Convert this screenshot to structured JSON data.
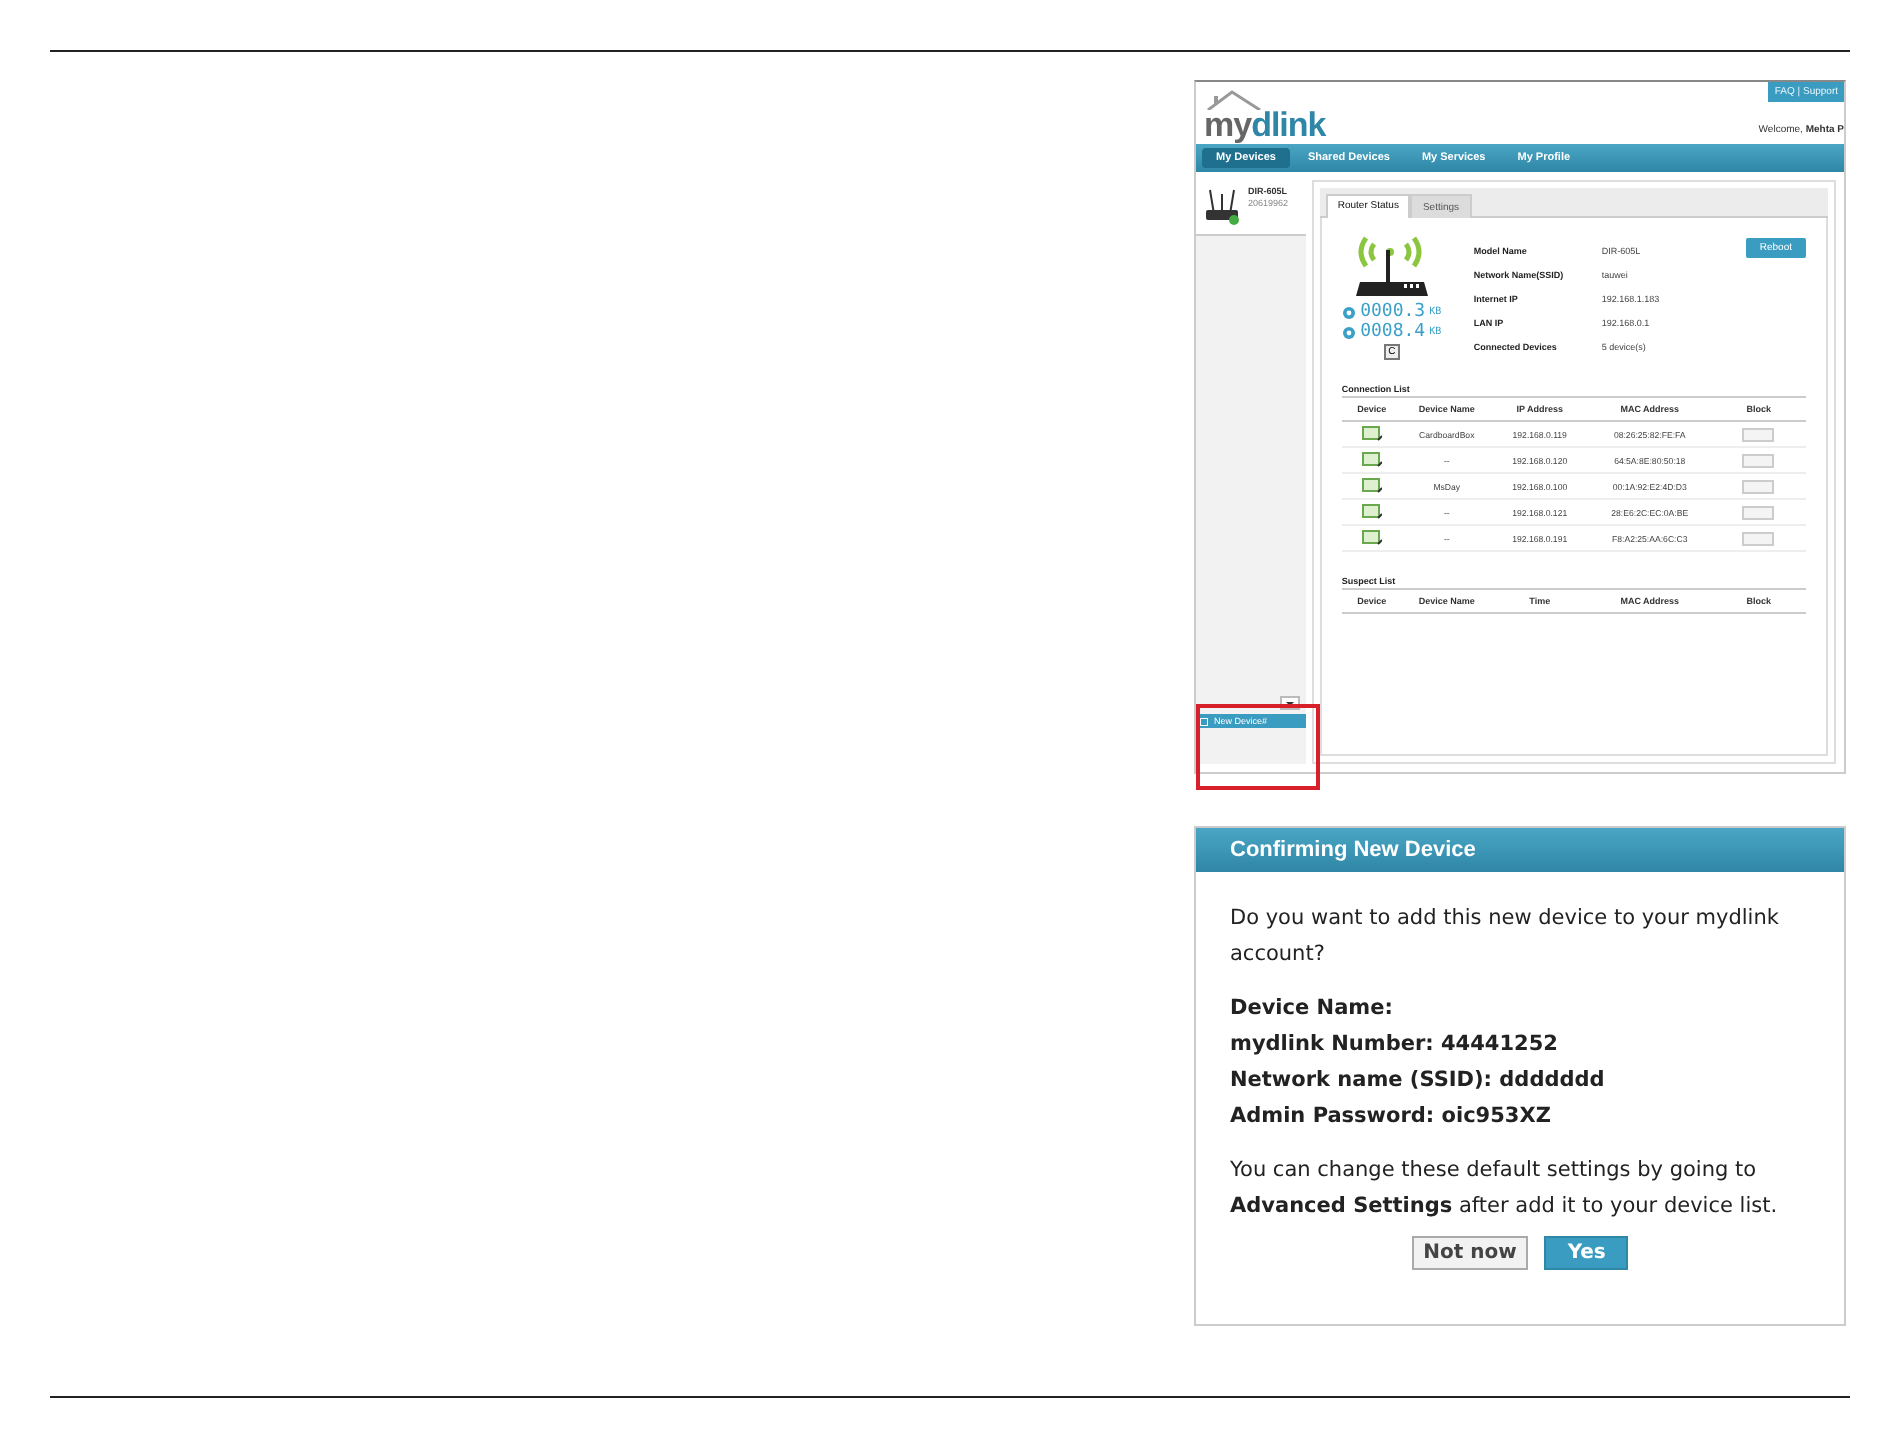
{
  "portal": {
    "header_links": "FAQ | Support",
    "logo": [
      "my",
      "dlink"
    ],
    "welcome": "Welcome, **Mehta P**",
    "nav": [
      {
        "label": "My Devices",
        "selected": true
      },
      {
        "label": "Shared Devices",
        "selected": false
      },
      {
        "label": "My Services",
        "selected": false
      },
      {
        "label": "My Profile",
        "selected": false
      }
    ],
    "devices": [
      {
        "name": "DIR-605L",
        "number": "20619962",
        "selected": true
      }
    ],
    "new_device": "New Device#",
    "tabs": [
      {
        "label": "Router Status",
        "selected": true
      },
      {
        "label": "Settings",
        "selected": false
      }
    ],
    "speeds": [
      {
        "value": "0000.3",
        "unit": "KB"
      },
      {
        "value": "0008.4",
        "unit": "KB"
      }
    ],
    "refresh": "C",
    "info": [
      {
        "label": "Model Name",
        "value": "DIR-605L"
      },
      {
        "label": "Network Name(SSID)",
        "value": "tauwei"
      },
      {
        "label": "Internet IP",
        "value": "192.168.1.183"
      },
      {
        "label": "LAN IP",
        "value": "192.168.0.1"
      },
      {
        "label": "Connected Devices",
        "value": "5 device(s)"
      }
    ],
    "reboot": "Reboot",
    "connection_list": {
      "title": "Connection List",
      "columns": [
        "Device",
        "Device Name",
        "IP Address",
        "MAC Address",
        "Block"
      ],
      "rows": [
        {
          "name": "CardboardBox",
          "ip": "192.168.0.119",
          "mac": "08:26:25:82:FE:FA",
          "blocked": false
        },
        {
          "name": "--",
          "ip": "192.168.0.120",
          "mac": "64:5A:8E:80:50:18",
          "blocked": false
        },
        {
          "name": "MsDay",
          "ip": "192.168.0.100",
          "mac": "00:1A:92:E2:4D:D3",
          "blocked": false
        },
        {
          "name": "--",
          "ip": "192.168.0.121",
          "mac": "28:E6:2C:EC:0A:BE",
          "blocked": false
        },
        {
          "name": "--",
          "ip": "192.168.0.191",
          "mac": "F8:A2:25:AA:6C:C3",
          "blocked": false
        }
      ]
    },
    "suspect_list": {
      "title": "Suspect List",
      "columns": [
        "Device",
        "Device Name",
        "Time",
        "MAC Address",
        "Block"
      ]
    }
  },
  "dialog": {
    "title": "Confirming New Device",
    "question": "Do you want to add this new device to your mydlink account?",
    "details": [
      "Device Name:",
      "mydlink Number: 44441252",
      "Network name (SSID): ddddddd",
      "Admin Password: oic953XZ"
    ],
    "note": "You can change these default settings by going to **Advanced Settings** after add it to your device list.",
    "buttons": [
      {
        "label": "Not now",
        "kind": "secondary"
      },
      {
        "label": "Yes",
        "kind": "primary"
      }
    ]
  }
}
